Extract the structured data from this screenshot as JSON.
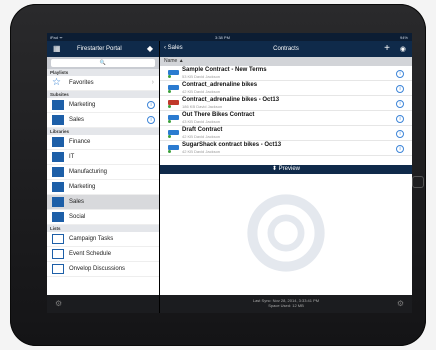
{
  "status": {
    "left": "iPad ᯤ",
    "time": "3:38 PM",
    "battery": "94%"
  },
  "left": {
    "title": "Firestarter Portal",
    "search_placeholder": "🔍",
    "sections": [
      {
        "label": "Playlists",
        "items": [
          {
            "label": "Favorites",
            "trail": "arrow"
          }
        ]
      },
      {
        "label": "Subsites",
        "items": [
          {
            "label": "Marketing",
            "trail": "info"
          },
          {
            "label": "Sales",
            "trail": "info"
          }
        ]
      },
      {
        "label": "Libraries",
        "items": [
          {
            "label": "Finance"
          },
          {
            "label": "IT"
          },
          {
            "label": "Manufacturing"
          },
          {
            "label": "Marketing"
          },
          {
            "label": "Sales",
            "selected": true
          },
          {
            "label": "Social"
          }
        ]
      },
      {
        "label": "Lists",
        "items": [
          {
            "label": "Campaign Tasks"
          },
          {
            "label": "Event Schedule"
          },
          {
            "label": "Onvelop Discussions"
          }
        ]
      }
    ]
  },
  "right": {
    "back": "Sales",
    "title": "Contracts",
    "column": "Name ▲",
    "docs": [
      {
        "name": "Sample Contract - New Terms",
        "meta": "53 KB  David Jackson",
        "icon": "#2b7bd0"
      },
      {
        "name": "Contract_adrenaline bikes",
        "meta": "42 KB  David Jackson",
        "icon": "#2b7bd0"
      },
      {
        "name": "Contract_adrenaline bikes - Oct13",
        "meta": "186 KB  David Jackson",
        "icon": "#c0392b"
      },
      {
        "name": "Out There Bikes Contract",
        "meta": "43 KB  David Jackson",
        "icon": "#2b7bd0"
      },
      {
        "name": "Draft Contract",
        "meta": "42 KB  David Jackson",
        "icon": "#2b7bd0"
      },
      {
        "name": "SugarShack contract bikes - Oct13",
        "meta": "42 KB  David Jackson",
        "icon": "#2b7bd0"
      }
    ],
    "preview": "Preview",
    "footer": {
      "sync": "Last Sync: Nov 28, 2014, 3:33:41 PM",
      "space": "Space Used: 12 MB"
    }
  }
}
